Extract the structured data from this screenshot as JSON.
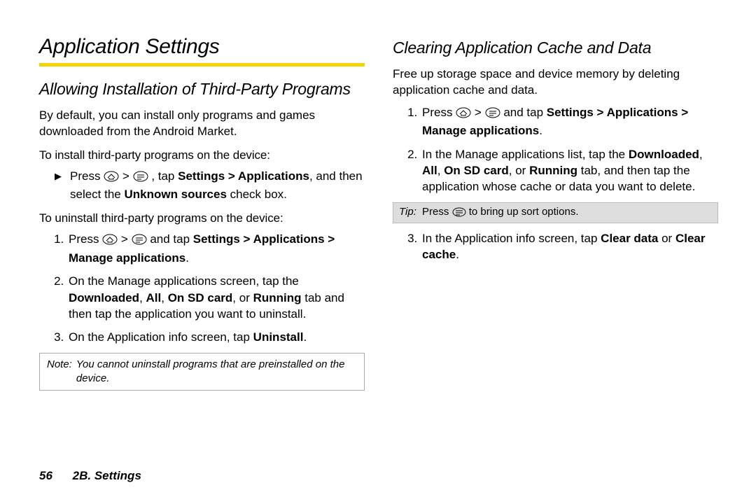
{
  "heading": "Application Settings",
  "left": {
    "subhead": "Allowing Installation of Third-Party Programs",
    "intro": "By default, you can install only programs and games downloaded from the Android Market.",
    "install_lead": "To install third-party programs on the device:",
    "install_bullet_pre": "Press ",
    "install_bullet_mid": ", tap ",
    "install_bullet_bold1": "Settings > Applications",
    "install_bullet_post1": ", and then select the ",
    "install_bullet_bold2": "Unknown sources",
    "install_bullet_post2": " check box.",
    "uninstall_lead": "To uninstall third-party programs on the device:",
    "u_item1_pre": "Press ",
    "u_item1_mid": " and tap ",
    "u_item1_bold": "Settings > Applications > Manage applications",
    "u_item1_post": ".",
    "u_item2_pre": "On the Manage applications screen, tap the ",
    "u_item2_b1": "Downloaded",
    "u_item2_s1": ", ",
    "u_item2_b2": "All",
    "u_item2_s2": ", ",
    "u_item2_b3": "On SD card",
    "u_item2_s3": ", or ",
    "u_item2_b4": "Running",
    "u_item2_post": " tab and then tap the application you want to uninstall.",
    "u_item3_pre": "On the Application info screen, tap ",
    "u_item3_bold": "Uninstall",
    "u_item3_post": ".",
    "note_label": "Note:",
    "note_body": "You cannot uninstall programs that are preinstalled on the device."
  },
  "right": {
    "subhead": "Clearing Application Cache and Data",
    "intro": "Free up storage space and device memory by deleting application cache and data.",
    "c_item1_pre": "Press ",
    "c_item1_mid": " and tap ",
    "c_item1_bold": "Settings > Applications > Manage applications",
    "c_item1_post": ".",
    "c_item2_pre": "In the Manage applications list, tap the ",
    "c_item2_b1": "Downloaded",
    "c_item2_s1": ", ",
    "c_item2_b2": "All",
    "c_item2_s2": ", ",
    "c_item2_b3": "On SD card",
    "c_item2_s3": ", or ",
    "c_item2_b4": "Running",
    "c_item2_post": " tab, and then tap the application whose cache or data you want to delete.",
    "tip_label": "Tip:",
    "tip_pre": "Press ",
    "tip_post": " to bring up sort options.",
    "c_item3_pre": "In the Application info screen, tap ",
    "c_item3_b1": "Clear data",
    "c_item3_s1": " or ",
    "c_item3_b2": "Clear cache",
    "c_item3_post": "."
  },
  "gt": " > ",
  "footer": {
    "page_number": "56",
    "section": "2B. Settings"
  }
}
